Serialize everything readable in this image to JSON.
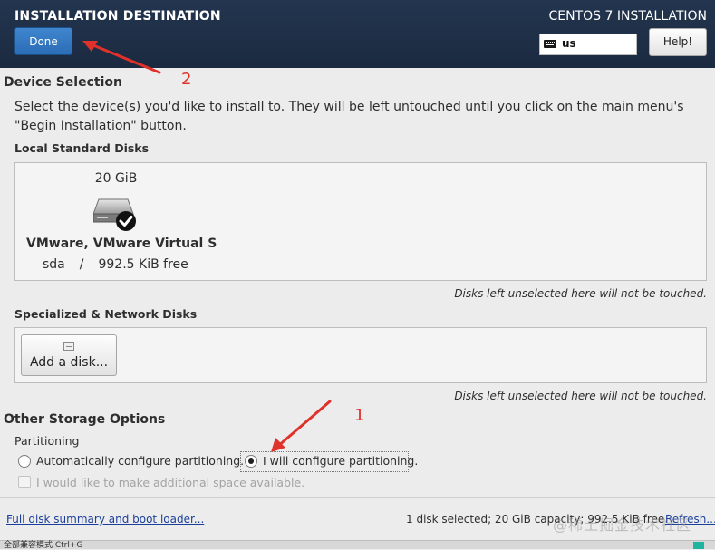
{
  "header": {
    "title": "INSTALLATION DESTINATION",
    "product": "CENTOS 7 INSTALLATION",
    "done_label": "Done",
    "keyboard_layout": "us",
    "help_label": "Help!"
  },
  "device_selection": {
    "title": "Device Selection",
    "intro": "Select the device(s) you'd like to install to.  They will be left untouched until you click on the main menu's \"Begin Installation\" button.",
    "local_disks_title": "Local Standard Disks",
    "disk": {
      "size": "20 GiB",
      "name": "VMware, VMware Virtual S",
      "device": "sda",
      "separator": "/",
      "free": "992.5 KiB free",
      "selected": true
    },
    "local_note": "Disks left unselected here will not be touched.",
    "network_disks_title": "Specialized & Network Disks",
    "add_disk_label": "Add a disk...",
    "network_note": "Disks left unselected here will not be touched."
  },
  "other_storage": {
    "title": "Other Storage Options",
    "partitioning_title": "Partitioning",
    "auto_label": "Automatically configure partitioning.",
    "manual_label": "I will configure partitioning.",
    "selected": "manual",
    "extra_space_label": "I would like to make additional space available."
  },
  "footer": {
    "summary_link": "Full disk summary and boot loader...",
    "status": "1 disk selected; 20 GiB capacity; 992.5 KiB free",
    "refresh_link": "Refresh..."
  },
  "annotations": {
    "step1": "1",
    "step2": "2",
    "color": "#e0312a"
  },
  "watermark": "@稀土掘金技术社区",
  "taskbar_text": "全部兼容模式 Ctrl+G"
}
